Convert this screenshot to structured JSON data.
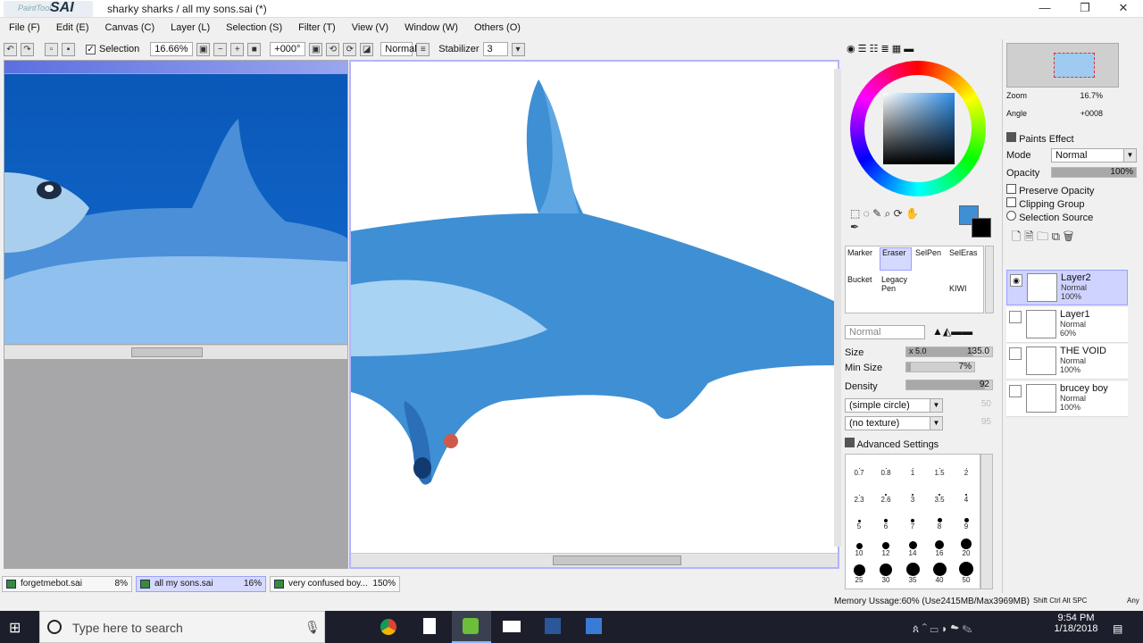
{
  "window": {
    "app_logo": {
      "small": "PaintTool",
      "big": "SAI"
    },
    "title": "sharky sharks / all my sons.sai (*)",
    "minimize": "—",
    "maximize": "❐",
    "close": "✕"
  },
  "menu": [
    {
      "label": "File (F)"
    },
    {
      "label": "Edit (E)"
    },
    {
      "label": "Canvas (C)"
    },
    {
      "label": "Layer (L)"
    },
    {
      "label": "Selection (S)"
    },
    {
      "label": "Filter (T)"
    },
    {
      "label": "View (V)"
    },
    {
      "label": "Window (W)"
    },
    {
      "label": "Others (O)"
    }
  ],
  "toolbar": {
    "selection_label": "Selection",
    "selection_checked": true,
    "zoom": "16.66%",
    "angle": "+000°",
    "blend_mode": "Normal",
    "stabilizer_label": "Stabilizer",
    "stabilizer_value": "3"
  },
  "color_panel": {
    "selected_color": "#3f8fd4",
    "background_color": "#000000"
  },
  "navigator": {
    "zoom_label": "Zoom",
    "zoom_value": "16.7%",
    "angle_label": "Angle",
    "angle_value": "+0008"
  },
  "paint_effect": {
    "header": "Paints Effect",
    "mode_label": "Mode",
    "mode_value": "Normal",
    "opacity_label": "Opacity",
    "opacity_value": "100%",
    "opacity_fraction": 1.0,
    "preserve_opacity": "Preserve Opacity",
    "clipping_group": "Clipping Group",
    "selection_source": "Selection Source"
  },
  "tools": [
    {
      "label": "Marker"
    },
    {
      "label": "Eraser"
    },
    {
      "label": "SelPen"
    },
    {
      "label": "SelEras"
    },
    {
      "label": "Bucket"
    },
    {
      "label": "Legacy Pen"
    },
    {
      "label": "KIWI"
    }
  ],
  "brush": {
    "blend_mode": "Normal",
    "size_label": "Size",
    "size_multiplier": "x 5.0",
    "size_value": "135.0",
    "size_fraction": 0.78,
    "min_size_label": "Min Size",
    "min_size_value": "7%",
    "min_size_fraction": 0.07,
    "density_label": "Density",
    "density_value": "92",
    "density_fraction": 0.92,
    "shape": "(simple circle)",
    "shape_value": "50",
    "texture": "(no texture)",
    "texture_value": "95",
    "advanced_label": "Advanced Settings",
    "sizes": [
      [
        "0.7",
        "0.8",
        "1",
        "1.5",
        "2"
      ],
      [
        "2.3",
        "2.6",
        "3",
        "3.5",
        "4"
      ],
      [
        "5",
        "6",
        "7",
        "8",
        "9"
      ],
      [
        "10",
        "12",
        "14",
        "16",
        "20"
      ],
      [
        "25",
        "30",
        "35",
        "40",
        "50"
      ]
    ]
  },
  "layers": [
    {
      "name": "Layer2",
      "mode": "Normal",
      "opacity": "100%",
      "selected": true
    },
    {
      "name": "Layer1",
      "mode": "Normal",
      "opacity": "60%",
      "selected": false
    },
    {
      "name": "THE VOID",
      "mode": "Normal",
      "opacity": "100%",
      "selected": false
    },
    {
      "name": "brucey boy",
      "mode": "Normal",
      "opacity": "100%",
      "selected": false
    }
  ],
  "tabs": [
    {
      "name": "forgetmebot.sai",
      "pct": "8%",
      "active": false
    },
    {
      "name": "all my sons.sai",
      "pct": "16%",
      "active": true
    },
    {
      "name": "very confused boy...",
      "pct": "150%",
      "active": false
    }
  ],
  "status": {
    "memory": "Memory Ussage:60% (Use2415MB/Max3969MB)",
    "keys": "Shift Ctrl Alt SPC",
    "any": "Any"
  },
  "taskbar": {
    "search_placeholder": "Type here to search",
    "time": "9:54 PM",
    "date": "1/18/2018"
  }
}
